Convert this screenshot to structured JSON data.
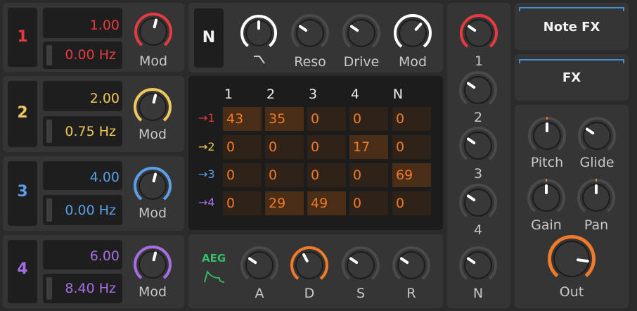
{
  "oscillators": [
    {
      "num": "1",
      "num_color": "#e8393f",
      "rate": "1.00",
      "freq": "0.00 Hz",
      "color": "#e8393f",
      "mod_label": "Mod",
      "mod_value": 0.55
    },
    {
      "num": "2",
      "num_color": "#f0c75a",
      "rate": "2.00",
      "freq": "0.75 Hz",
      "color": "#f0c75a",
      "mod_label": "Mod",
      "mod_value": 0.55
    },
    {
      "num": "3",
      "num_color": "#5a9ee8",
      "rate": "4.00",
      "freq": "0.00 Hz",
      "color": "#5a9ee8",
      "mod_label": "Mod",
      "mod_value": 0.55
    },
    {
      "num": "4",
      "num_color": "#a56ee6",
      "rate": "6.00",
      "freq": "8.40 Hz",
      "color": "#a56ee6",
      "mod_label": "Mod",
      "mod_value": 0.55
    }
  ],
  "filter": {
    "n_label": "N",
    "knobs": [
      {
        "label": "",
        "icon": "filter-slope-icon",
        "value": 0.5
      },
      {
        "label": "Reso",
        "value": 0.3
      },
      {
        "label": "Drive",
        "value": 0.3
      },
      {
        "label": "Mod",
        "value": 0.65
      }
    ]
  },
  "matrix": {
    "columns": [
      "1",
      "2",
      "3",
      "4",
      "N"
    ],
    "rows": [
      {
        "label": "→1",
        "color": "#e8393f",
        "values": [
          "43",
          "35",
          "0",
          "0",
          "0"
        ]
      },
      {
        "label": "→2",
        "color": "#f0c75a",
        "values": [
          "0",
          "0",
          "0",
          "17",
          "0"
        ]
      },
      {
        "label": "→3",
        "color": "#5a9ee8",
        "values": [
          "0",
          "0",
          "0",
          "0",
          "69"
        ]
      },
      {
        "label": "→4",
        "color": "#a56ee6",
        "values": [
          "0",
          "29",
          "49",
          "0",
          "0"
        ]
      }
    ],
    "value_color": "#f07a28"
  },
  "envelope": {
    "label": "AEG",
    "label_color": "#35c06b",
    "icon": "envelope-shape-icon",
    "knobs": [
      {
        "label": "A",
        "value": 0.3
      },
      {
        "label": "D",
        "value": 0.4,
        "active": true
      },
      {
        "label": "S",
        "value": 0.3
      },
      {
        "label": "R",
        "value": 0.3
      }
    ]
  },
  "output_knobs": [
    {
      "label": "1",
      "value": 0.3,
      "color": "#e8393f"
    },
    {
      "label": "2",
      "value": 0.3
    },
    {
      "label": "3",
      "value": 0.3
    },
    {
      "label": "4",
      "value": 0.3
    },
    {
      "label": "N",
      "value": 0.3
    }
  ],
  "fx": {
    "note_fx": "Note FX",
    "fx": "FX",
    "knobs": [
      {
        "label": "Pitch",
        "value": 0.5
      },
      {
        "label": "Glide",
        "value": 0.3
      },
      {
        "label": "Gain",
        "value": 0.5
      },
      {
        "label": "Pan",
        "value": 0.5
      }
    ],
    "out": {
      "label": "Out",
      "value": 0.85
    }
  },
  "colors": {
    "accent_orange": "#f07a28",
    "accent_blue": "#4a8ecf",
    "knob_track": "#4a4a4a",
    "text_gray": "#c8c8c8"
  }
}
